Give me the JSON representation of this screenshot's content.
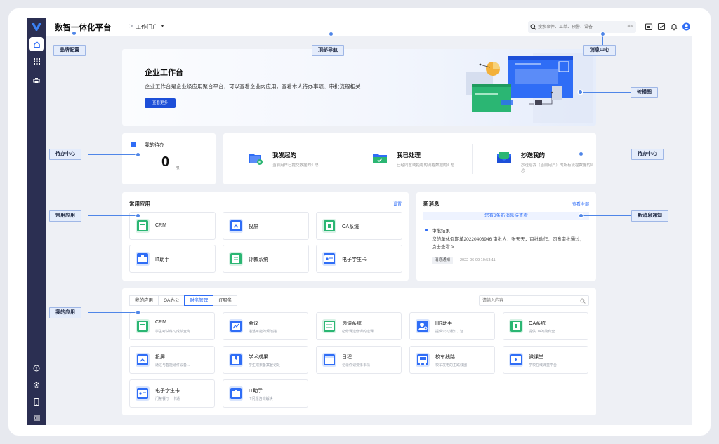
{
  "app": {
    "brand": "数智一体化平台",
    "breadcrumb_sep": ">",
    "breadcrumb": "工作门户",
    "breadcrumb_caret": "▾"
  },
  "search": {
    "placeholder": "搜索事件、工单、预警、设备",
    "shortcut": "⌘K"
  },
  "banner": {
    "title": "企业工作台",
    "desc": "企业工作台是企业级应用聚合平台，可以查看企业内应用，查看本人待办事项、审批流程相关",
    "button": "查看更多"
  },
  "pending": {
    "title": "我的待办",
    "count": "0",
    "unit": "项"
  },
  "tasks": [
    {
      "title": "我发起的",
      "sub": "当前用户已提交数据的汇总",
      "icon": "send-folder-icon"
    },
    {
      "title": "我已处理",
      "sub": "已经同意或拒绝的流程数据的汇总",
      "icon": "check-folder-icon"
    },
    {
      "title": "抄送我的",
      "sub": "抄送给我（当前用户）的所有流程数据的汇总",
      "icon": "cc-mail-icon"
    }
  ],
  "common": {
    "title": "常用应用",
    "link": "设置",
    "apps": [
      {
        "name": "CRM",
        "icon": "crm-icon",
        "color": "#2bb673"
      },
      {
        "name": "投屏",
        "icon": "cast-icon",
        "color": "#2f6df6"
      },
      {
        "name": "OA系统",
        "icon": "oa-icon",
        "color": "#2bb673"
      },
      {
        "name": "IT助手",
        "icon": "toolbox-icon",
        "color": "#2f6df6"
      },
      {
        "name": "评教系统",
        "icon": "evaluation-icon",
        "color": "#2bb673"
      },
      {
        "name": "电子学生卡",
        "icon": "student-card-icon",
        "color": "#2f6df6"
      }
    ]
  },
  "news": {
    "title": "新消息",
    "link": "查看全部",
    "banner": "您有3条新消息待查看",
    "heading": "审批结果",
    "body": "您的单休假期单20220403946 审批人：张天天，审批动作：同意审批通过，点击查看 >",
    "tag": "消息通知",
    "time": "2022-06-09 10:53:11"
  },
  "myapps": {
    "tabs": [
      "我的应用",
      "OA办公",
      "财务管理",
      "IT服务"
    ],
    "active_tab": 2,
    "search_placeholder": "请输入内容",
    "apps": [
      {
        "name": "CRM",
        "desc": "学生考试练习成绩查询",
        "icon": "crm-icon",
        "color": "#2bb673"
      },
      {
        "name": "会议",
        "desc": "描述可能的规范描...",
        "icon": "meeting-icon",
        "color": "#2f6df6"
      },
      {
        "name": "选课系统",
        "desc": "必修课选修课的选课...",
        "icon": "course-icon",
        "color": "#2bb673"
      },
      {
        "name": "HR助手",
        "desc": "提供公司通知、证...",
        "icon": "hr-icon",
        "color": "#2f6df6"
      },
      {
        "name": "OA系统",
        "desc": "提供OA的简有全...",
        "icon": "oa-icon",
        "color": "#2bb673"
      },
      {
        "name": "投屏",
        "desc": "通过与智能硬件设备...",
        "icon": "cast-icon",
        "color": "#2f6df6"
      },
      {
        "name": "学术成果",
        "desc": "学生成果备案登记处",
        "icon": "book-icon",
        "color": "#2f6df6"
      },
      {
        "name": "日程",
        "desc": "记录你记要事事情",
        "icon": "calendar-icon",
        "color": "#2f6df6"
      },
      {
        "name": "校车线路",
        "desc": "校车发电的主路线图",
        "icon": "bus-icon",
        "color": "#2f6df6"
      },
      {
        "name": "微课堂",
        "desc": "学校在线课堂平台",
        "icon": "video-icon",
        "color": "#2f6df6"
      },
      {
        "name": "电子学生卡",
        "desc": "门禁餐厅一卡通",
        "icon": "student-card-icon",
        "color": "#2f6df6"
      },
      {
        "name": "IT助手",
        "desc": "IT问题咨询解决",
        "icon": "toolbox-icon",
        "color": "#2f6df6"
      }
    ]
  },
  "callouts": {
    "brand": "品牌配置",
    "topnav": "顶部导航",
    "message_center": "消息中心",
    "carousel": "轮播图",
    "todo_left": "待办中心",
    "todo_right": "待办中心",
    "common_apps": "常用应用",
    "news_notice": "新消息通知",
    "my_apps": "我的应用"
  },
  "colors": {
    "sidebar": "#2b2f52",
    "accent": "#2f6df6",
    "green": "#2bb673",
    "callout_bg": "#e4ecfb"
  }
}
